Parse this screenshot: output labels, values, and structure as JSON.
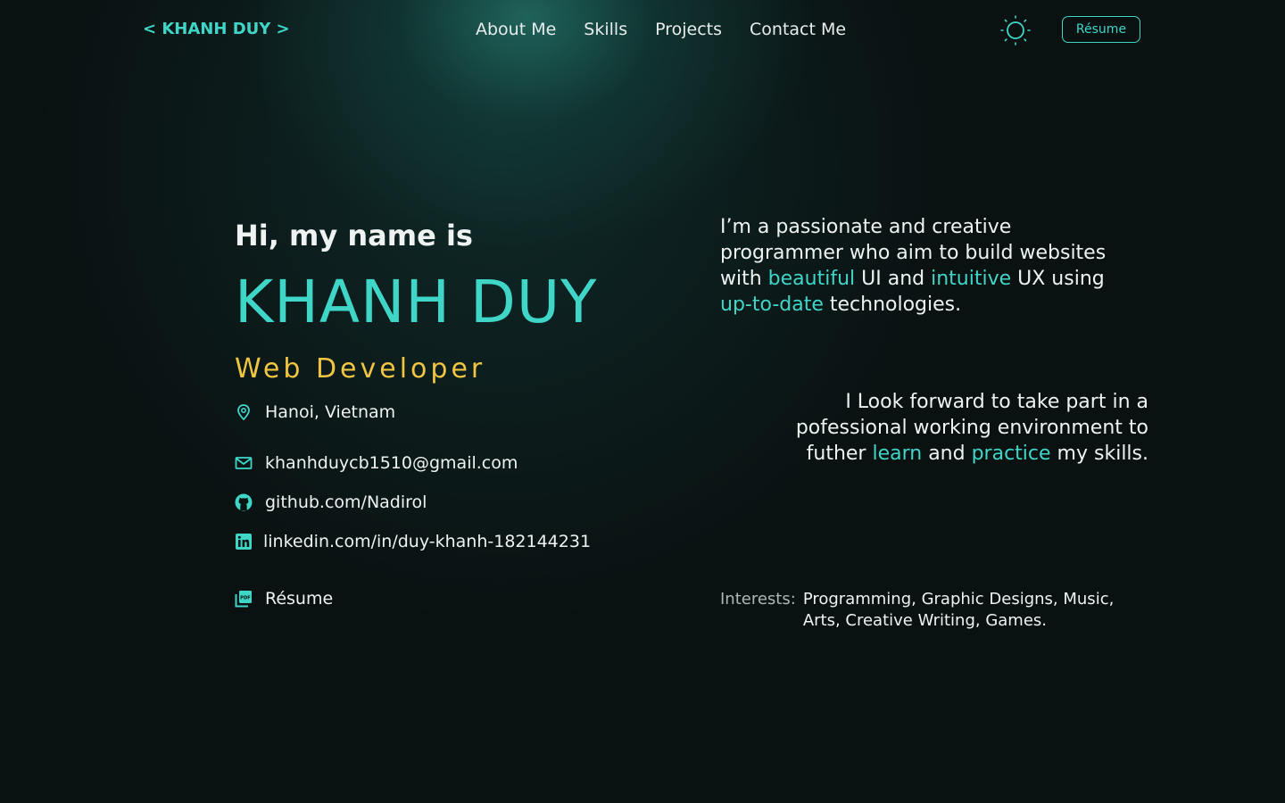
{
  "nav": {
    "logo": "< KHANH DUY >",
    "links": [
      "About Me",
      "Skills",
      "Projects",
      "Contact Me"
    ],
    "theme_icon": "sun-icon",
    "resume_button": "Résume"
  },
  "hero": {
    "greeting": "Hi, my name is",
    "name": "KHANH DUY",
    "role": "Web Developer",
    "location": "Hanoi, Vietnam",
    "email": "khanhduycb1510@gmail.com",
    "github": "github.com/Nadirol",
    "linkedin": "linkedin.com/in/duy-khanh-182144231",
    "resume_link": "Résume"
  },
  "about": {
    "p1": {
      "t1": "I’m a passionate and creative programmer who aim to build websites with ",
      "h1": "beautiful",
      "t2": " UI and ",
      "h2": "intuitive",
      "t3": " UX using ",
      "h3": "up-to-date",
      "t4": " technologies."
    },
    "p2": {
      "t1": "I Look forward to take part in a pofessional working environment to futher ",
      "h1": "learn",
      "t2": " and ",
      "h2": "practice",
      "t3": " my skills."
    },
    "interests_label": "Interests:",
    "interests_list": "Programming, Graphic Designs, Music, Arts,  Creative Writing, Games."
  },
  "colors": {
    "background": "#0a1111",
    "accent": "#3fd6c8",
    "role": "#f0c542",
    "text": "#eef3f2"
  }
}
